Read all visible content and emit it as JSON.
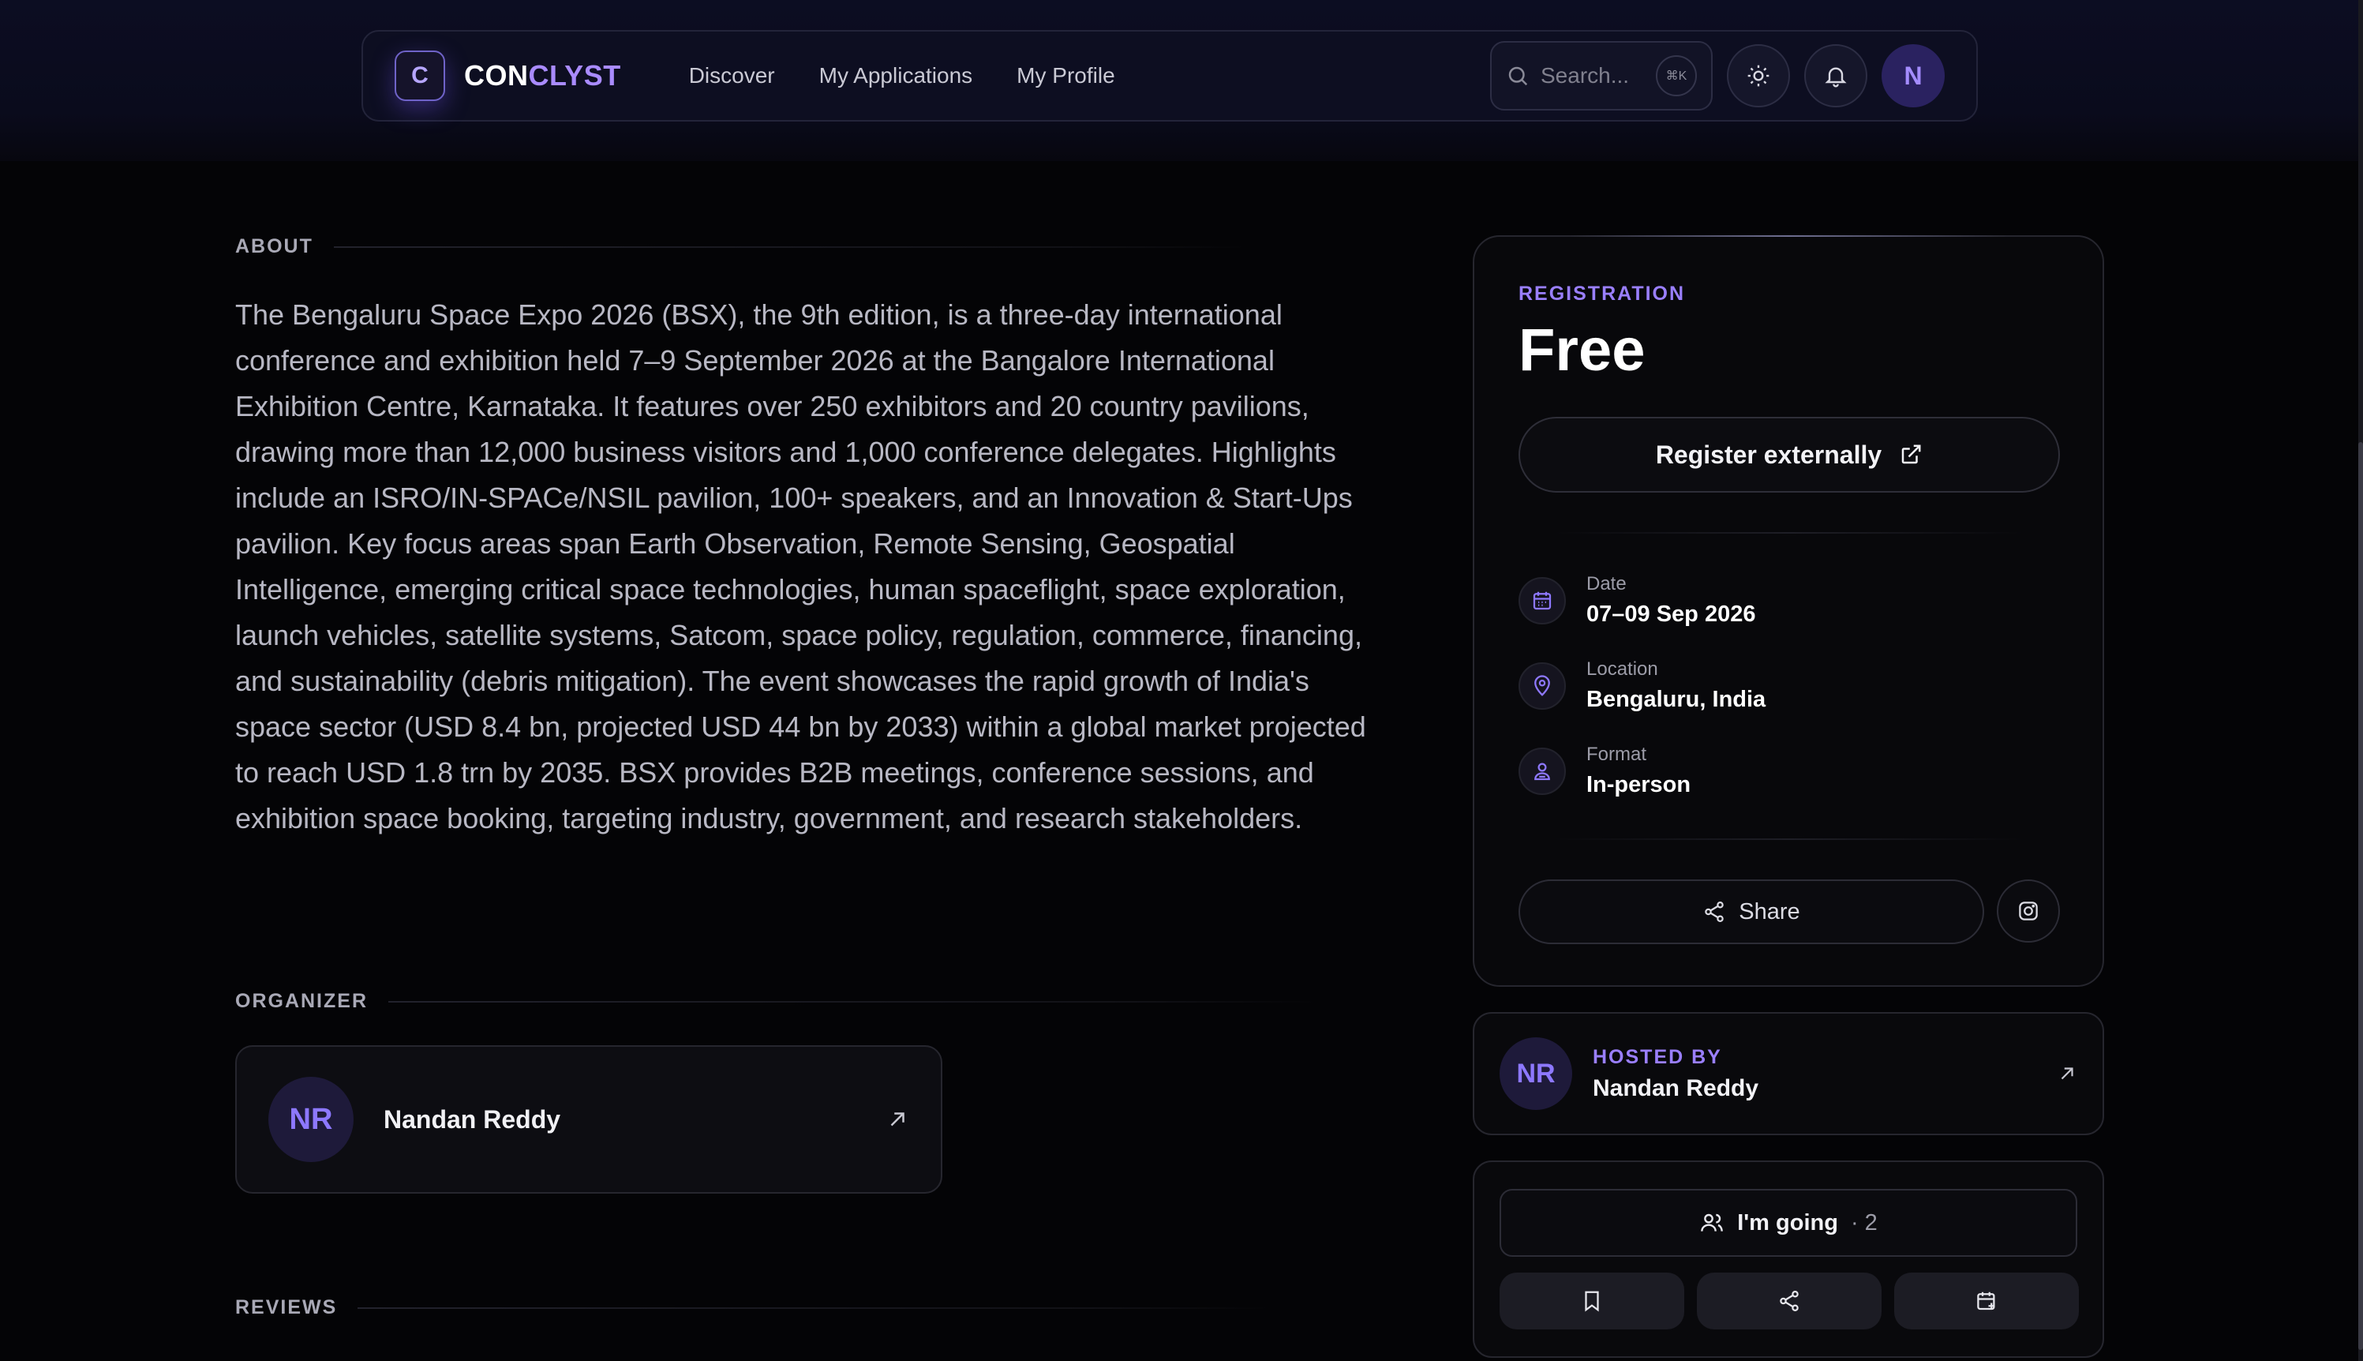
{
  "nav": {
    "logo_letter": "C",
    "brand_part1": "CON",
    "brand_part2": "CLYST",
    "links": [
      "Discover",
      "My Applications",
      "My Profile"
    ],
    "search_placeholder": "Search...",
    "search_shortcut": "⌘K",
    "avatar_initial": "N"
  },
  "about": {
    "heading": "ABOUT",
    "text": "The Bengaluru Space Expo 2026 (BSX), the 9th edition, is a three-day international conference and exhibition held 7–9 September 2026 at the Bangalore International Exhibition Centre, Karnataka. It features over 250 exhibitors and 20 country pavilions, drawing more than 12,000 business visitors and 1,000 conference delegates. Highlights include an ISRO/IN-SPACe/NSIL pavilion, 100+ speakers, and an Innovation & Start-Ups pavilion. Key focus areas span Earth Observation, Remote Sensing, Geospatial Intelligence, emerging critical space technologies, human spaceflight, space exploration, launch vehicles, satellite systems, Satcom, space policy, regulation, commerce, financing, and sustainability (debris mitigation). The event showcases the rapid growth of India's space sector (USD 8.4 bn, projected USD 44 bn by 2033) within a global market projected to reach USD 1.8 trn by 2035. BSX provides B2B meetings, conference sessions, and exhibition space booking, targeting industry, government, and research stakeholders."
  },
  "organizer": {
    "heading": "ORGANIZER",
    "initials": "NR",
    "name": "Nandan Reddy"
  },
  "reviews": {
    "heading": "REVIEWS"
  },
  "registration": {
    "label": "REGISTRATION",
    "price": "Free",
    "register_button": "Register externally",
    "date_label": "Date",
    "date_value": "07–09 Sep 2026",
    "location_label": "Location",
    "location_value": "Bengaluru, India",
    "format_label": "Format",
    "format_value": "In-person",
    "share_button": "Share"
  },
  "host": {
    "label": "HOSTED BY",
    "initials": "NR",
    "name": "Nandan Reddy"
  },
  "rsvp": {
    "going_label": "I'm going",
    "going_count": "· 2"
  },
  "colors": {
    "accent": "#9a7fff",
    "background": "#040406",
    "brand_highlight": "#a98bff"
  }
}
